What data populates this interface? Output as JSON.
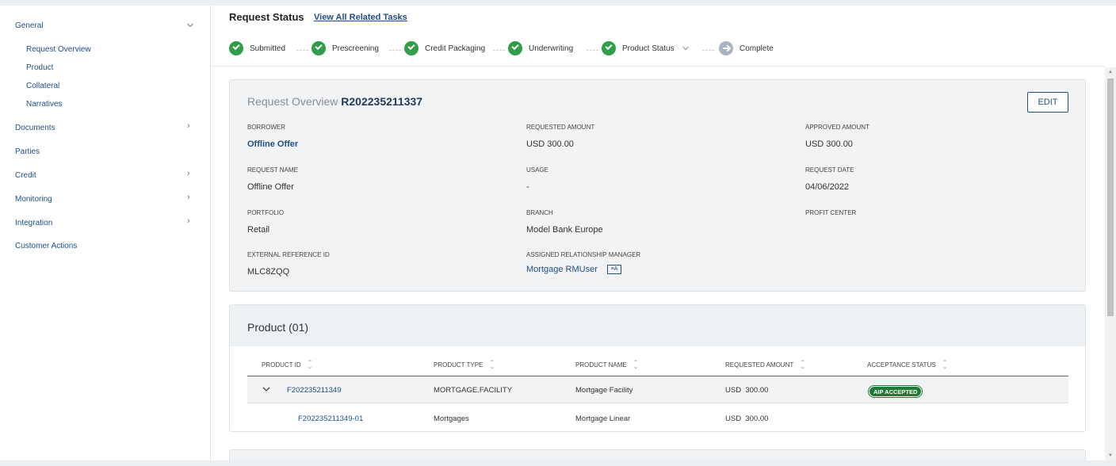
{
  "sidebar": {
    "general": "General",
    "sub_items": [
      "Request Overview",
      "Product",
      "Collateral",
      "Narratives"
    ],
    "items": [
      "Documents",
      "Parties",
      "Credit",
      "Monitoring",
      "Integration",
      "Customer Actions"
    ]
  },
  "request_status": {
    "title": "Request Status",
    "link": "View All Related Tasks",
    "steps": [
      "Submitted",
      "Prescreening",
      "Credit Packaging",
      "Underwriting",
      "Product Status",
      "Complete"
    ]
  },
  "overview": {
    "title_prefix": "Request Overview",
    "request_id": "R202235211337",
    "edit_label": "EDIT",
    "fields": {
      "borrower_label": "BORROWER",
      "borrower": "Offline Offer",
      "requested_amount_label": "REQUESTED AMOUNT",
      "requested_amount": "USD 300.00",
      "approved_amount_label": "APPROVED AMOUNT",
      "approved_amount": "USD 300.00",
      "request_name_label": "REQUEST NAME",
      "request_name": "Offline Offer",
      "usage_label": "USAGE",
      "usage": "-",
      "request_date_label": "REQUEST DATE",
      "request_date": "04/06/2022",
      "portfolio_label": "PORTFOLIO",
      "portfolio": "Retail",
      "branch_label": "BRANCH",
      "branch": "Model Bank Europe",
      "profit_center_label": "PROFIT CENTER",
      "ext_ref_label": "EXTERNAL REFERENCE ID",
      "ext_ref": "MLC8ZQQ",
      "rm_label": "ASSIGNED RELATIONSHIP MANAGER",
      "rm": "Mortgage RMUser",
      "rm_icon_text": "≡A"
    }
  },
  "product": {
    "title": "Product (01)",
    "columns": [
      "PRODUCT ID",
      "PRODUCT TYPE",
      "PRODUCT NAME",
      "REQUESTED AMOUNT",
      "ACCEPTANCE STATUS"
    ],
    "rows": [
      {
        "id": "F202235211349",
        "type": "MORTGAGE.FACILITY",
        "name": "Mortgage Facility",
        "amount": "USD  300.00",
        "status": "AIP ACCEPTED"
      },
      {
        "id": "F202235211349-01",
        "type": "Mortgages",
        "name": "Mortgage Linear",
        "amount": "USD  300.00"
      }
    ]
  },
  "colors": {
    "accent": "#1f4f86",
    "success": "#2e9e48",
    "badge": "#1e7a34"
  }
}
